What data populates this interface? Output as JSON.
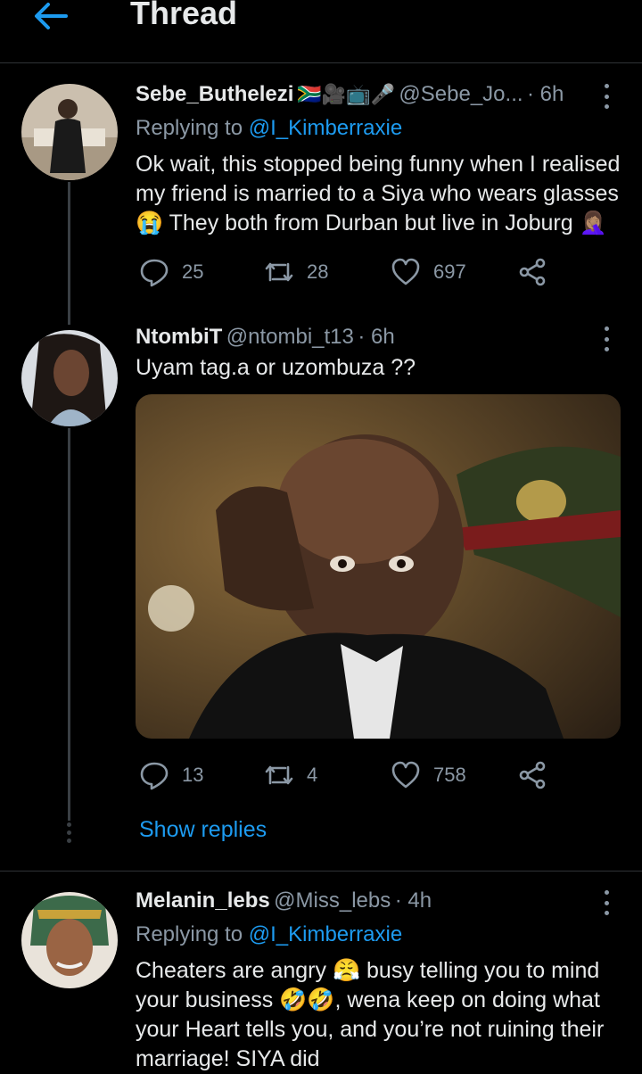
{
  "header": {
    "title": "Thread"
  },
  "tweets": [
    {
      "name": "Sebe_Buthelezi",
      "name_emojis": "🇿🇦🎥📺🎤",
      "handle": "@Sebe_Jo...",
      "time": "· 6h",
      "replying_prefix": "Replying to",
      "replying_to": "@I_Kimberraxie",
      "text_1": "Ok wait, this stopped being funny when I realised",
      "text_2": "my friend is married to a Siya who wears glasses",
      "text_3": "😭 They both from Durban but live in Joburg 🤦🏽‍♀️",
      "replies": "25",
      "retweets": "28",
      "likes": "697"
    },
    {
      "name": "NtombiT",
      "handle": "@ntombi_t13",
      "time": "· 6h",
      "text_1": "Uyam tag.a or uzombuza ??",
      "replies": "13",
      "retweets": "4",
      "likes": "758",
      "show_replies": "Show replies"
    },
    {
      "name": "Melanin_lebs",
      "handle": "@Miss_lebs",
      "time": "· 4h",
      "replying_prefix": "Replying to",
      "replying_to": "@I_Kimberraxie",
      "text_1": "Cheaters are angry 😤 busy telling you to mind",
      "text_2": "your business 🤣🤣, wena keep on doing what",
      "text_3": "your Heart tells you, and you’re not ruining their",
      "text_4": "marriage! SIYA did"
    }
  ],
  "colors": {
    "accent": "#1d9bf0",
    "background": "#000000",
    "muted": "#8b98a5"
  },
  "icons": [
    "back-arrow-icon",
    "more-vertical-icon",
    "reply-icon",
    "retweet-icon",
    "like-icon",
    "share-icon"
  ]
}
